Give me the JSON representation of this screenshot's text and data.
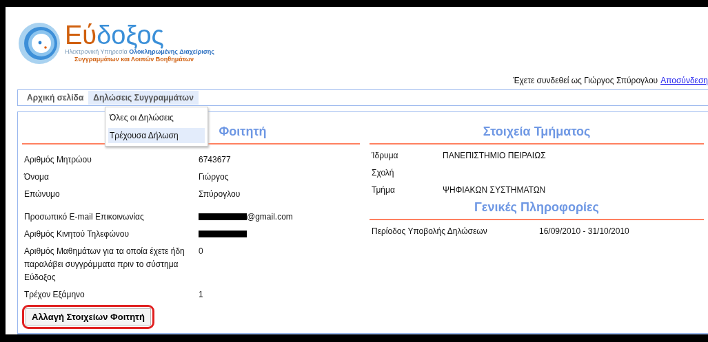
{
  "logo": {
    "name_accent": "Εύ",
    "name_rest": "δοξος",
    "tagline_plain": "Ηλεκτρονική Υπηρεσία",
    "tagline_accent": "Ολοκληρωμένης Διαχείρισης",
    "tagline_second": "Συγγραμμάτων και Λοιπών Βοηθημάτων"
  },
  "login": {
    "text": "Έχετε συνδεθεί ως Γιώργος Σπύρογλου",
    "logout_link": "Αποσύνδεση"
  },
  "menu": [
    {
      "label": "Αρχική σελίδα",
      "selected": false
    },
    {
      "label": "Δηλώσεις Συγγραμμάτων",
      "selected": true
    }
  ],
  "dropdown": [
    {
      "label": "Όλες οι Δηλώσεις",
      "selected": false
    },
    {
      "label": "Τρέχουσα Δήλωση",
      "selected": true
    }
  ],
  "student": {
    "heading": "Φοιτητή",
    "rows": [
      {
        "label": "Αριθμός Μητρώου",
        "value": "6743677",
        "redacted": false
      },
      {
        "label": "Όνομα",
        "value": "Γιώργος",
        "redacted": false
      },
      {
        "label": "Επώνυμο",
        "value": "Σπύρογλου",
        "redacted": false
      }
    ],
    "contact_rows": [
      {
        "label": "Προσωπικό E-mail Επικοινωνίας",
        "value": "@gmail.com",
        "redacted": true
      },
      {
        "label": "Αριθμός Κινητού Τηλεφώνου",
        "redacted": true
      },
      {
        "label": "Αριθμός Μαθημάτων για τα οποία έχετε ήδη παραλάβει συγγράμματα πριν το σύστημα Εύδοξος",
        "value": "0",
        "redacted": false
      },
      {
        "label": "Τρέχον Εξάμηνο",
        "value": "1",
        "redacted": false
      }
    ],
    "button": {
      "label": "Αλλαγή Στοιχείων Φοιτητή",
      "highlighted": true
    }
  },
  "department": {
    "heading": "Στοιχεία Τμήματος",
    "rows": [
      {
        "label": "Ίδρυμα",
        "value": "ΠΑΝΕΠΙΣΤΗΜΙΟ ΠΕΙΡΑΙΩΣ"
      },
      {
        "label": "Σχολή"
      },
      {
        "label": "Τμήμα",
        "value": "ΨΗΦΙΑΚΩΝ ΣΥΣΤΗΜΑΤΩΝ"
      }
    ]
  },
  "general": {
    "heading": "Γενικές Πληροφορίες",
    "rows": [
      {
        "label": "Περίοδος Υποβολής Δηλώσεων",
        "value": "16/09/2010 - 31/10/2010"
      }
    ]
  }
}
